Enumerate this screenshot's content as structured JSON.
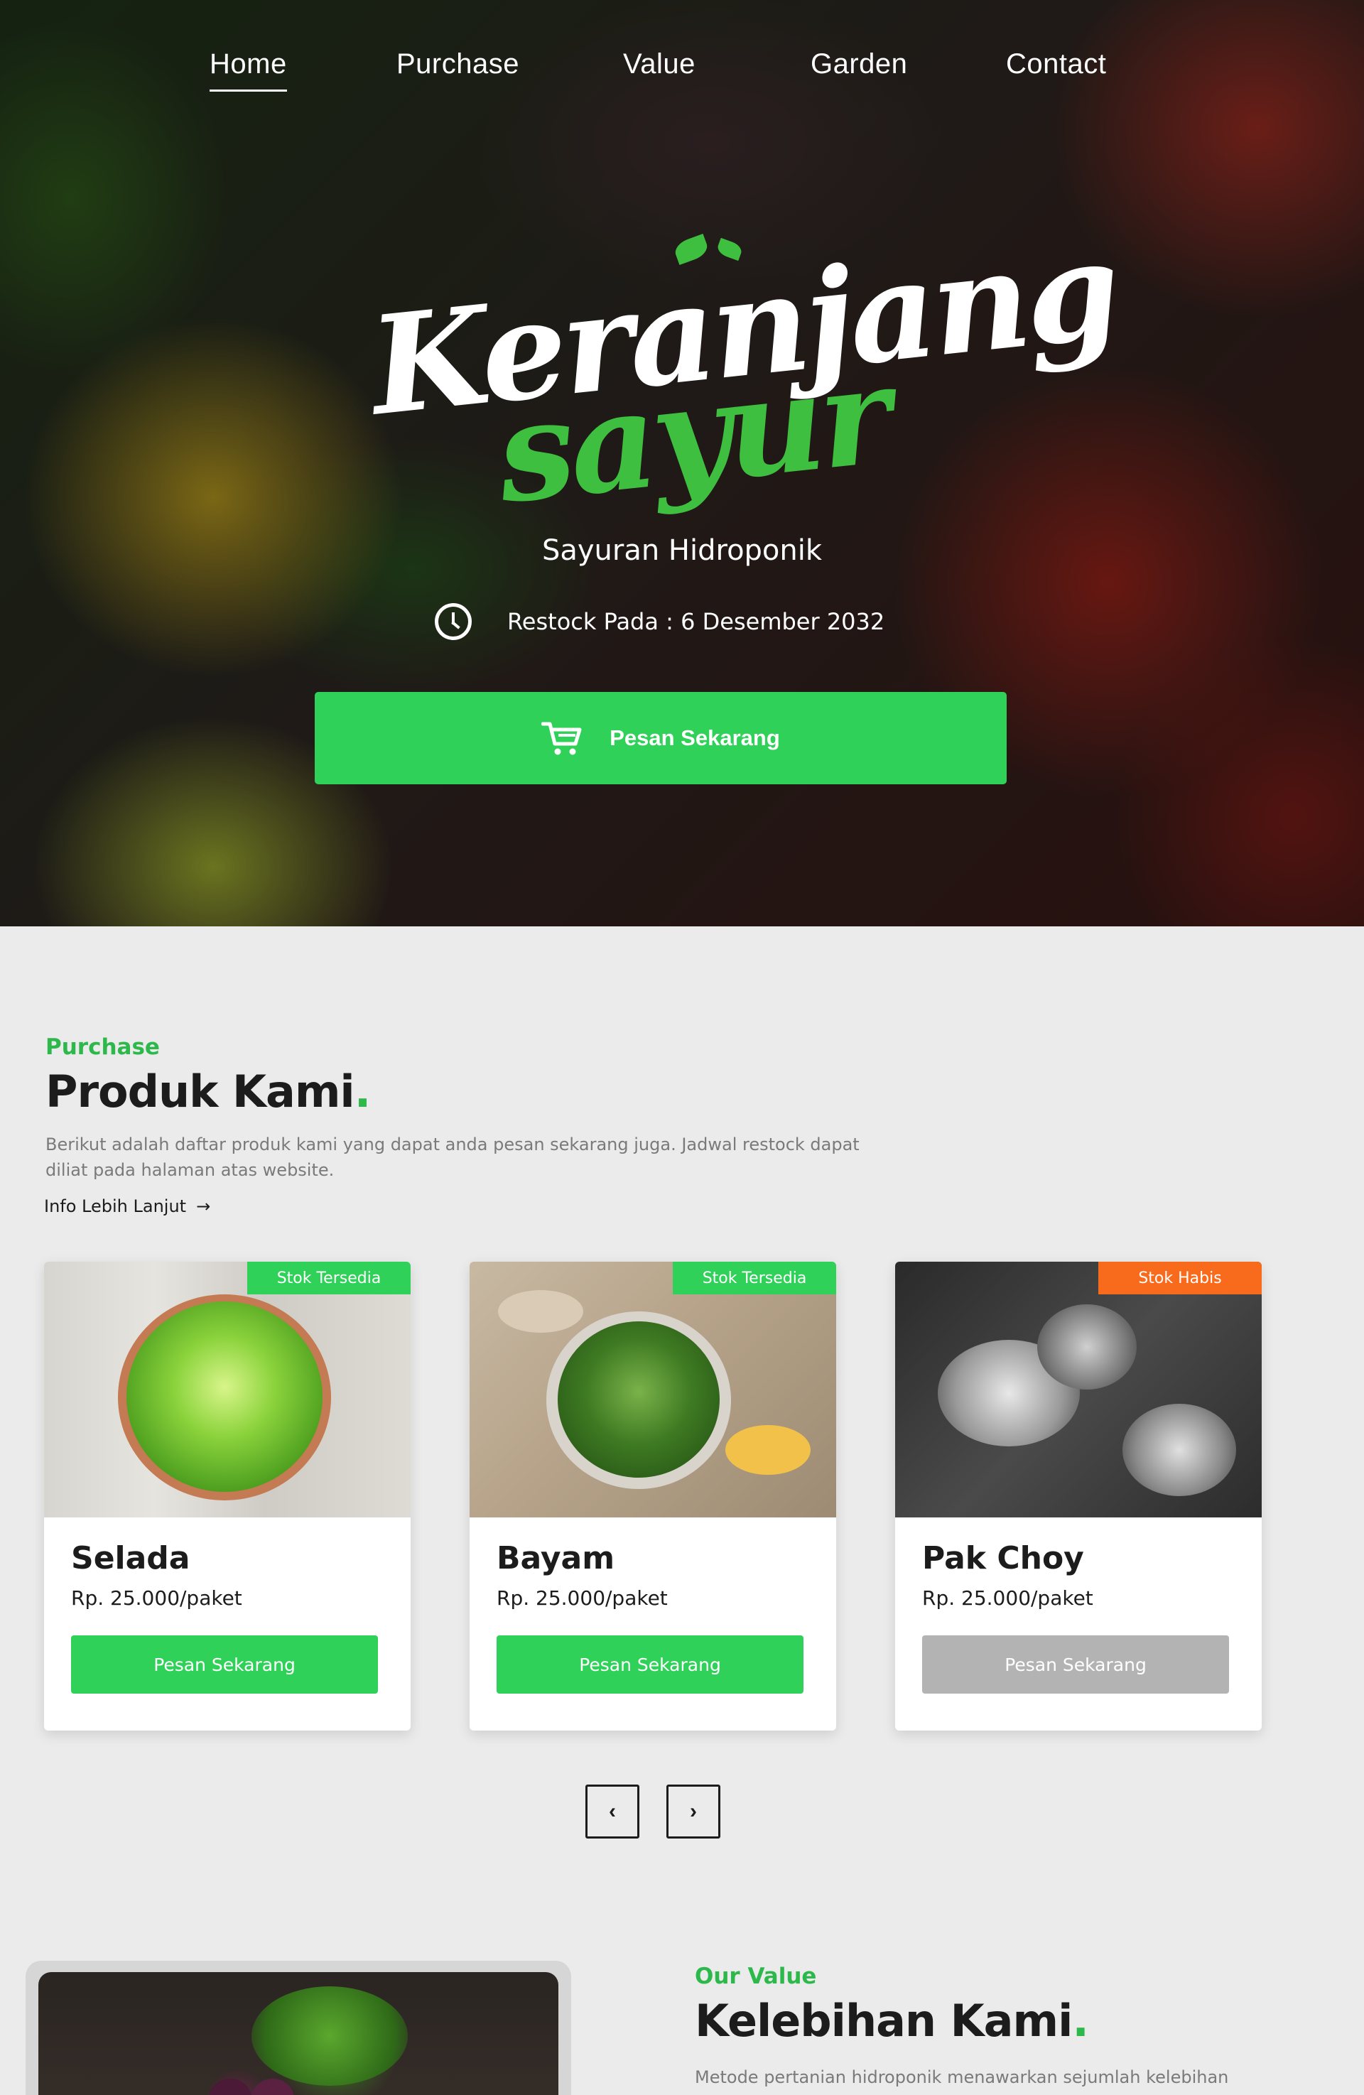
{
  "nav": {
    "items": [
      {
        "label": "Home",
        "active": true
      },
      {
        "label": "Purchase",
        "active": false
      },
      {
        "label": "Value",
        "active": false
      },
      {
        "label": "Garden",
        "active": false
      },
      {
        "label": "Contact",
        "active": false
      }
    ]
  },
  "hero": {
    "logo_line1": "Keranjang",
    "logo_line2": "sayur",
    "tagline": "Sayuran Hidroponik",
    "restock": "Restock Pada : 6 Desember 2032",
    "cta_label": "Pesan Sekarang",
    "icons": [
      "clock-icon",
      "cart-icon"
    ]
  },
  "products_section": {
    "eyebrow": "Purchase",
    "title": "Produk Kami",
    "title_dot": ".",
    "description": "Berikut adalah daftar produk kami yang dapat anda pesan sekarang juga. Jadwal restock dapat diliat  pada halaman atas website.",
    "more_link": "Info Lebih Lanjut",
    "products": [
      {
        "name": "Selada",
        "price": "Rp. 25.000/paket",
        "badge": "Stok Tersedia",
        "button": "Pesan Sekarang",
        "available": true
      },
      {
        "name": "Bayam",
        "price": "Rp. 25.000/paket",
        "badge": "Stok Tersedia",
        "button": "Pesan Sekarang",
        "available": true
      },
      {
        "name": "Pak Choy",
        "price": "Rp. 25.000/paket",
        "badge": "Stok Habis",
        "button": "Pesan Sekarang",
        "available": false
      }
    ],
    "pager": {
      "prev": "‹",
      "next": "›"
    }
  },
  "value_section": {
    "eyebrow": "Our Value",
    "title": "Kelebihan Kami",
    "title_dot": ".",
    "description": "Metode pertanian hidroponik menawarkan sejumlah kelebihan"
  },
  "colors": {
    "accent": "#30d159",
    "accent_text": "#2db84c",
    "out_of_stock": "#f86a1c",
    "disabled": "#b3b3b3",
    "background": "#ebebeb"
  }
}
